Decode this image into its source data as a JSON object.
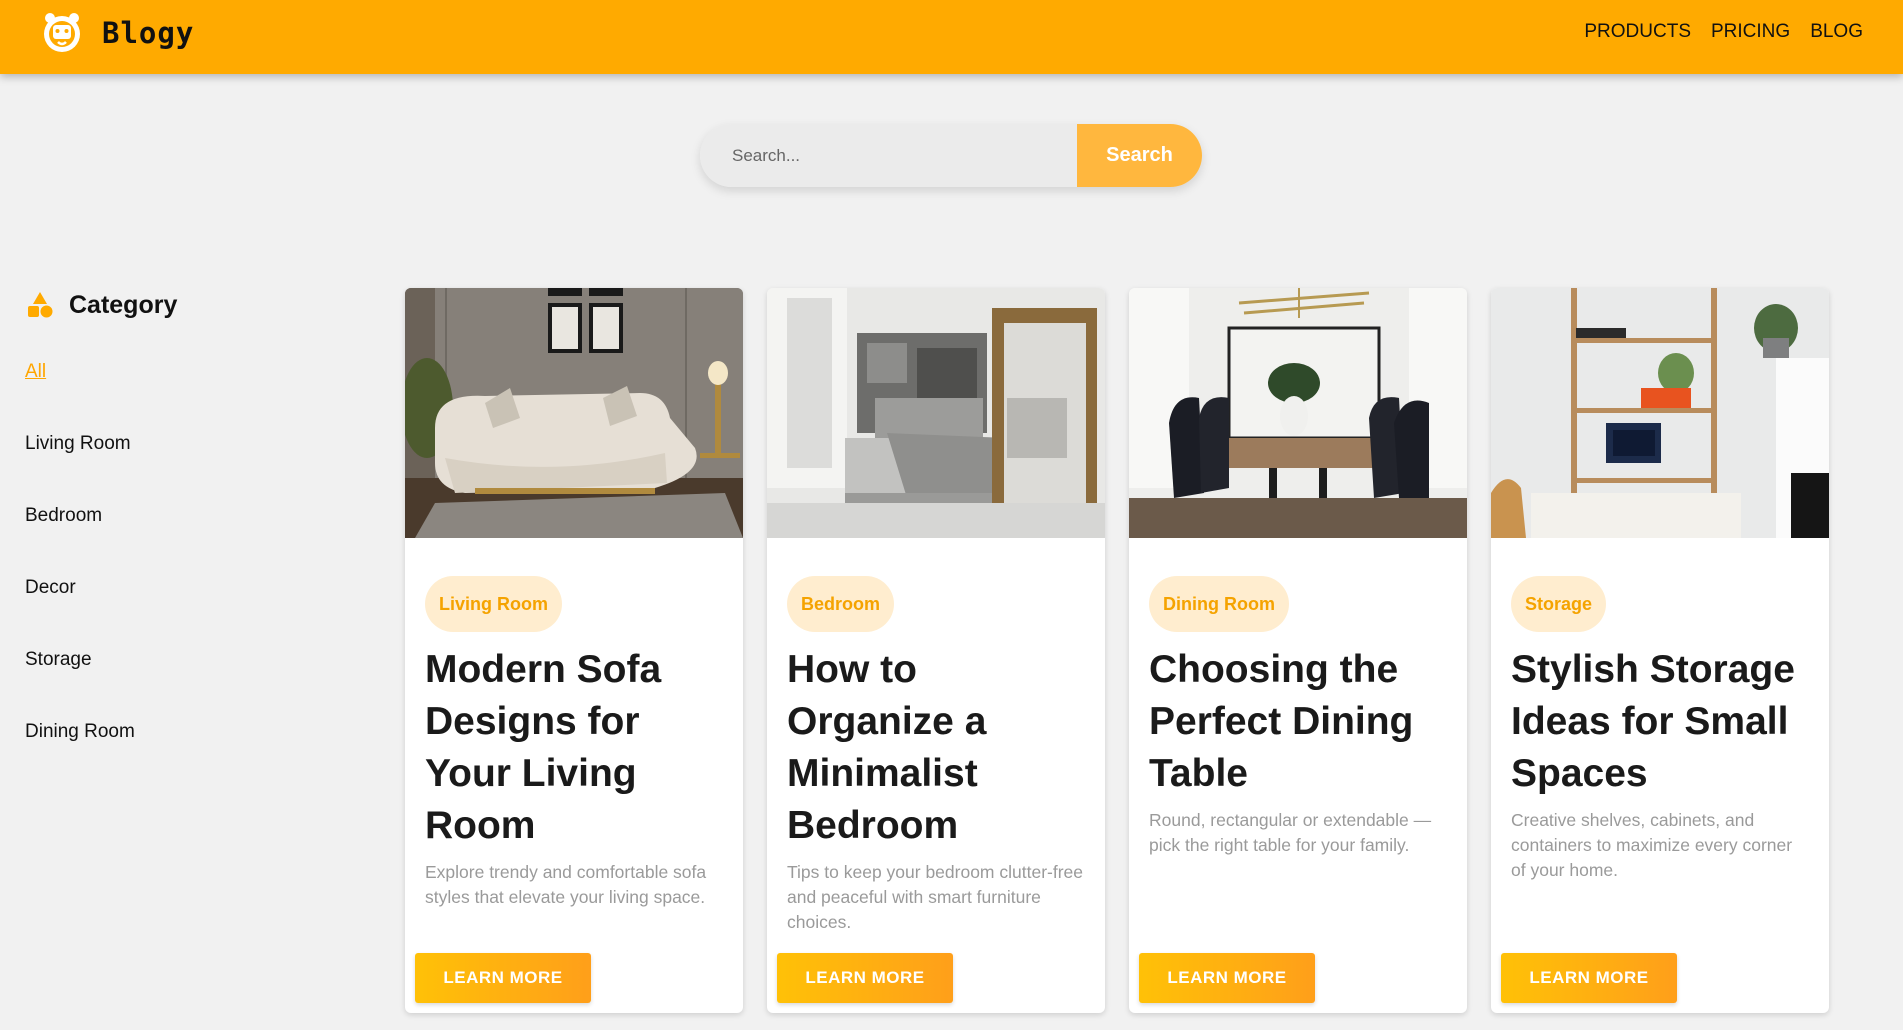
{
  "header": {
    "brand": "Blogy",
    "nav": [
      "PRODUCTS",
      "PRICING",
      "BLOG"
    ]
  },
  "search": {
    "placeholder": "Search...",
    "button": "Search"
  },
  "sidebar": {
    "title": "Category",
    "items": [
      "All",
      "Living Room",
      "Bedroom",
      "Decor",
      "Storage",
      "Dining Room"
    ],
    "active": "All"
  },
  "cards": [
    {
      "tag": "Living Room",
      "title": "Modern Sofa Designs for Your Living Room",
      "description": "Explore trendy and comfortable sofa styles that elevate your living space.",
      "button": "LEARN MORE"
    },
    {
      "tag": "Bedroom",
      "title": "How to Organize a Minimalist Bedroom",
      "description": "Tips to keep your bedroom clutter-free and peaceful with smart furniture choices.",
      "button": "LEARN MORE"
    },
    {
      "tag": "Dining Room",
      "title": "Choosing the Perfect Dining Table",
      "description": "Round, rectangular or extendable — pick the right table for your family.",
      "button": "LEARN MORE"
    },
    {
      "tag": "Storage",
      "title": "Stylish Storage Ideas for Small Spaces",
      "description": "Creative shelves, cabinets, and containers to maximize every corner of your home.",
      "button": "LEARN MORE"
    }
  ],
  "colors": {
    "accent": "#ffaa00",
    "tag_bg": "#ffedcf",
    "tag_text": "#f5a300",
    "page_bg": "#f1f1f1"
  },
  "icons": {
    "logo": "cat-face-logo-icon",
    "category": "shapes-icon"
  }
}
